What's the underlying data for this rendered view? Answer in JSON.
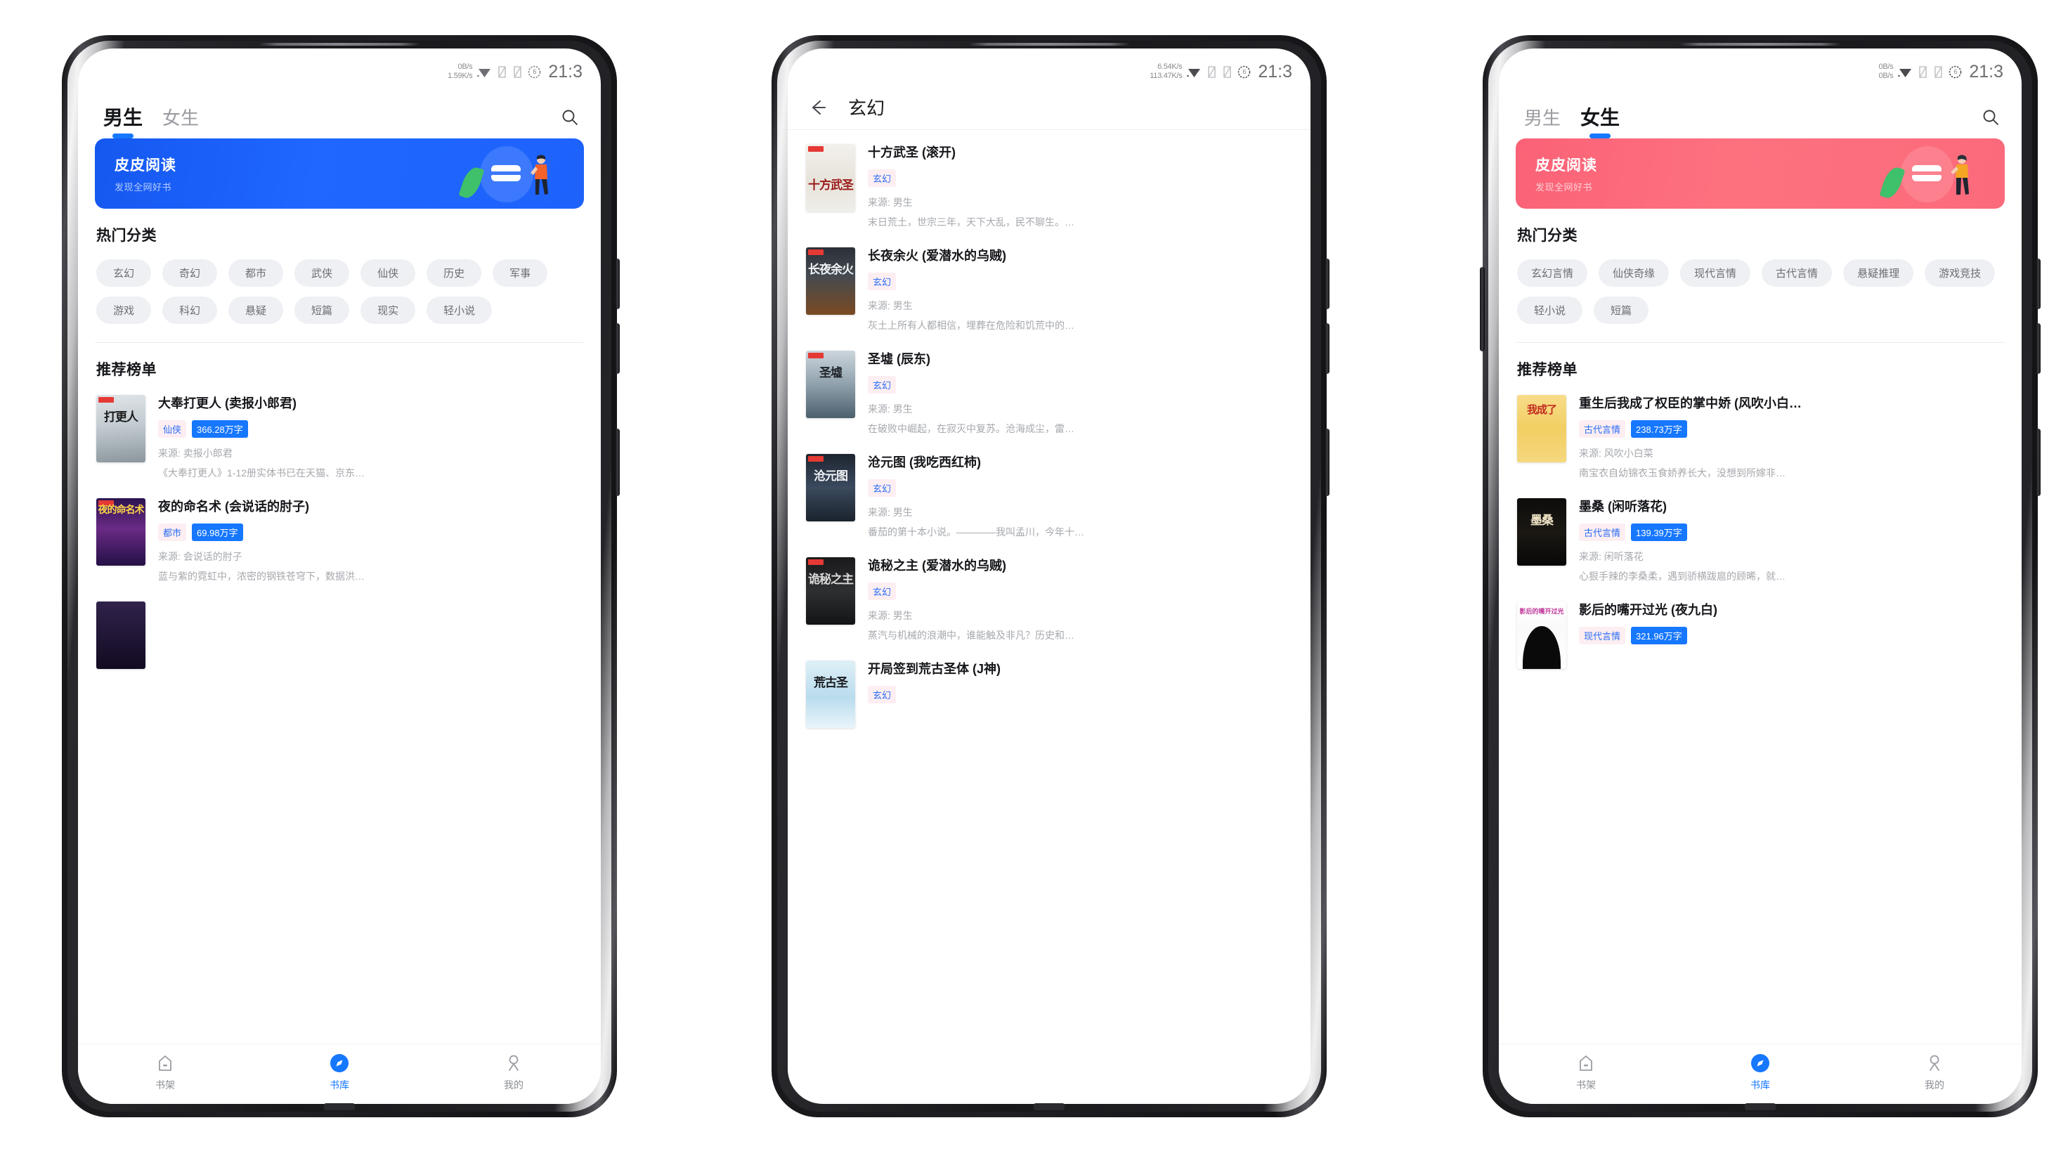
{
  "app": {
    "name": "皮皮阅读",
    "banner_title": "皮皮阅读",
    "banner_sub": "发现全网好书",
    "section_hot": "热门分类",
    "section_rank": "推荐榜单"
  },
  "status_bar": {
    "p1": {
      "up": "0B/s",
      "down": "1.59K/s",
      "battery": "6",
      "time": "21:3"
    },
    "p2": {
      "up": "6.54K/s",
      "down": "113.47K/s",
      "battery": "6",
      "time": "21:3"
    },
    "p3": {
      "up": "0B/s",
      "down": "0B/s",
      "battery": "6",
      "time": "21:3"
    }
  },
  "nav": {
    "items": [
      {
        "label": "书架",
        "icon": "bookshelf-icon",
        "active": false
      },
      {
        "label": "书库",
        "icon": "compass-icon",
        "active": true
      },
      {
        "label": "我的",
        "icon": "user-icon",
        "active": false
      }
    ]
  },
  "phone1": {
    "tabs": [
      {
        "label": "男生",
        "active": true
      },
      {
        "label": "女生",
        "active": false
      }
    ],
    "search_icon": "search-icon",
    "banner_color": "#1f67ff",
    "categories": [
      "玄幻",
      "奇幻",
      "都市",
      "武侠",
      "仙侠",
      "历史",
      "军事",
      "游戏",
      "科幻",
      "悬疑",
      "短篇",
      "现实",
      "轻小说"
    ],
    "books": [
      {
        "title": "大奉打更人 (卖报小郎君)",
        "category": "仙侠",
        "words": "366.28万字",
        "source": "来源: 卖报小郎君",
        "desc": "《大奉打更人》1-12册实体书已在天猫、京东…",
        "cover": "cv-dagengren",
        "cover_text": "打更人"
      },
      {
        "title": "夜的命名术 (会说话的肘子)",
        "category": "都市",
        "words": "69.98万字",
        "source": "来源: 会说话的肘子",
        "desc": "蓝与紫的霓虹中，浓密的钢铁苍穹下，数据洪…",
        "cover": "cv-yedemingming",
        "cover_text": "夜的命名术"
      },
      {
        "title": "",
        "category": "",
        "words": "",
        "source": "",
        "desc": "",
        "cover": "cv-partial",
        "cover_text": ""
      }
    ]
  },
  "phone2": {
    "back_icon": "back-arrow-icon",
    "title": "玄幻",
    "books": [
      {
        "title": "十方武圣 (滚开)",
        "category": "玄幻",
        "source": "来源: 男生",
        "desc": "末日荒土，世宗三年，天下大乱，民不聊生。…",
        "cover": "cv-shifang",
        "cover_text": "十方武圣"
      },
      {
        "title": "长夜余火 (爱潜水的乌贼)",
        "category": "玄幻",
        "source": "来源: 男生",
        "desc": "灰土上所有人都相信，埋葬在危险和饥荒中的…",
        "cover": "cv-changye",
        "cover_text": "长夜余火"
      },
      {
        "title": "圣墟 (辰东)",
        "category": "玄幻",
        "source": "来源: 男生",
        "desc": "在破败中崛起，在寂灭中复苏。沧海成尘，雷…",
        "cover": "cv-shengxu",
        "cover_text": "圣墟"
      },
      {
        "title": "沧元图 (我吃西红柿)",
        "category": "玄幻",
        "source": "来源: 男生",
        "desc": "番茄的第十本小说。————我叫孟川，今年十…",
        "cover": "cv-cangyuan",
        "cover_text": "沧元图"
      },
      {
        "title": "诡秘之主 (爱潜水的乌贼)",
        "category": "玄幻",
        "source": "来源: 男生",
        "desc": "蒸汽与机械的浪潮中，谁能触及非凡？历史和…",
        "cover": "cv-guimi",
        "cover_text": "诡秘之主"
      },
      {
        "title": "开局签到荒古圣体 (J神)",
        "category": "玄幻",
        "source": "",
        "desc": "",
        "cover": "cv-huanggu",
        "cover_text": "荒古圣"
      }
    ]
  },
  "phone3": {
    "tabs": [
      {
        "label": "男生",
        "active": false
      },
      {
        "label": "女生",
        "active": true
      }
    ],
    "search_icon": "search-icon",
    "banner_color": "#fb6277",
    "categories": [
      "玄幻言情",
      "仙侠奇缘",
      "现代言情",
      "古代言情",
      "悬疑推理",
      "游戏竞技",
      "轻小说",
      "短篇"
    ],
    "books": [
      {
        "title": "重生后我成了权臣的掌中娇 (风吹小白…",
        "category": "古代言情",
        "words": "238.73万字",
        "source": "来源: 风吹小白菜",
        "desc": "南宝衣自幼锦衣玉食娇养长大，没想到所嫁非…",
        "cover": "cv-chongsheng",
        "cover_text": "我成了"
      },
      {
        "title": "墨桑 (闲听落花)",
        "category": "古代言情",
        "words": "139.39万字",
        "source": "来源: 闲听落花",
        "desc": "心狠手辣的李桑柔，遇到骄横跋扈的顾晞，就…",
        "cover": "cv-mosang",
        "cover_text": "墨桑"
      },
      {
        "title": "影后的嘴开过光 (夜九白)",
        "category": "现代言情",
        "words": "321.96万字",
        "source": "",
        "desc": "",
        "cover": "cv-yinghou",
        "cover_text": "影后的嘴开过光"
      }
    ]
  },
  "colors": {
    "accent_blue": "#1677ff",
    "accent_pink": "#fb6277",
    "tag_bg": "#fdeef2",
    "tag_text": "#2a6df5",
    "chip_bg": "#eef0f3",
    "muted": "#a6a8ad"
  }
}
